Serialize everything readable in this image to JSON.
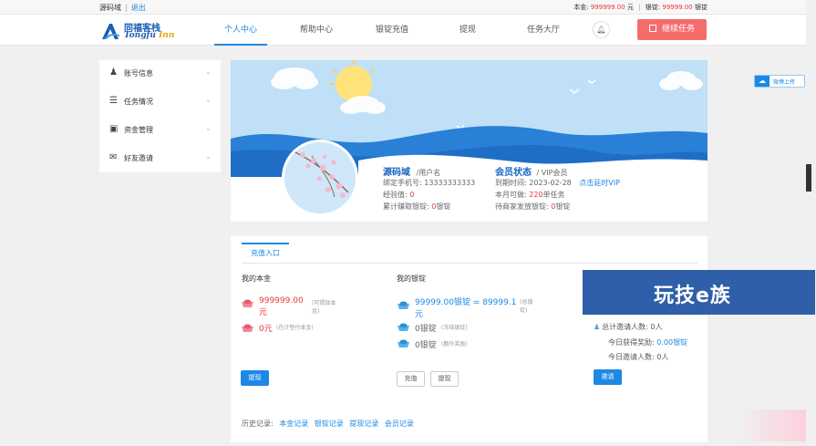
{
  "topbar": {
    "username": "源码域",
    "logout": "退出",
    "principal_label": "本金:",
    "principal_value": "999999.00",
    "principal_unit": "元",
    "ingot_label": "银锭:",
    "ingot_value": "99999.00",
    "ingot_unit": "银锭"
  },
  "logo": {
    "cn": "同福客栈",
    "en_a": "Tongfu ",
    "en_b": "Inn"
  },
  "nav": [
    {
      "label": "个人中心"
    },
    {
      "label": "帮助中心"
    },
    {
      "label": "银锭充值"
    },
    {
      "label": "提现"
    },
    {
      "label": "任务大厅"
    }
  ],
  "header": {
    "bell_icon": "bell-icon",
    "task_button": "继续任务"
  },
  "sidebar": {
    "items": [
      {
        "label": "账号信息",
        "icon": "user-icon"
      },
      {
        "label": "任务情况",
        "icon": "list-icon"
      },
      {
        "label": "资金管理",
        "icon": "money-icon"
      },
      {
        "label": "好友邀请",
        "icon": "mail-icon"
      }
    ]
  },
  "profile": {
    "name": "源码域",
    "name_suffix": "/用户名",
    "phone_label": "绑定手机号:",
    "phone": "13333333333",
    "exp_label": "经验值:",
    "exp": "0",
    "total_label": "累计赚取银锭:",
    "total": "0",
    "total_unit": "银锭",
    "vip_title": "会员状态",
    "vip_level": "/ VIP会员",
    "expire_label": "到期时间:",
    "expire": "2023-02-28",
    "renew": "点击延时VIP",
    "month_label": "本月可做:",
    "month": "220",
    "month_unit": "单任务",
    "pending_label": "待商家发放银锭:",
    "pending": "0",
    "pending_unit": "银锭"
  },
  "share": {
    "label": "微博上传"
  },
  "panel": {
    "tab": "充值入口",
    "principal_title": "我的本金",
    "principal_amount_a": "999999.00",
    "principal_amount_b": "元",
    "principal_note_a": "(可提现本",
    "principal_note_b": "金)",
    "principal_frozen": "0元",
    "principal_frozen_note": "(在计垫付本金)",
    "withdraw_button": "提现",
    "ingot_title": "我的银锭",
    "ingot_amount_a": "99999.00银锭 = 89999.1",
    "ingot_amount_b": "元",
    "ingot_note_a": "(总银",
    "ingot_note_b": "锭)",
    "ingot_frozen": "0银锭",
    "ingot_frozen_note": "(冻结银锭)",
    "ingot_extra": "0银锭",
    "ingot_extra_note": "(额外奖励)",
    "recharge_button": "充值",
    "ingot_withdraw_button": "提现",
    "invite_total": "总计邀请人数: 0人",
    "invite_today_reward_label": "今日获得奖励:",
    "invite_today_reward": "0.00银锭",
    "invite_today_count": "今日邀请人数: 0人",
    "invite_button": "邀请",
    "history_label": "历史记录:",
    "history_links": [
      "本金记录",
      "银锭记录",
      "提现记录",
      "会员记录"
    ]
  },
  "watermark": {
    "text": "玩技e族"
  },
  "colors": {
    "accent": "#1e88e5",
    "danger": "#f56c6c",
    "money_red": "#e53935"
  }
}
